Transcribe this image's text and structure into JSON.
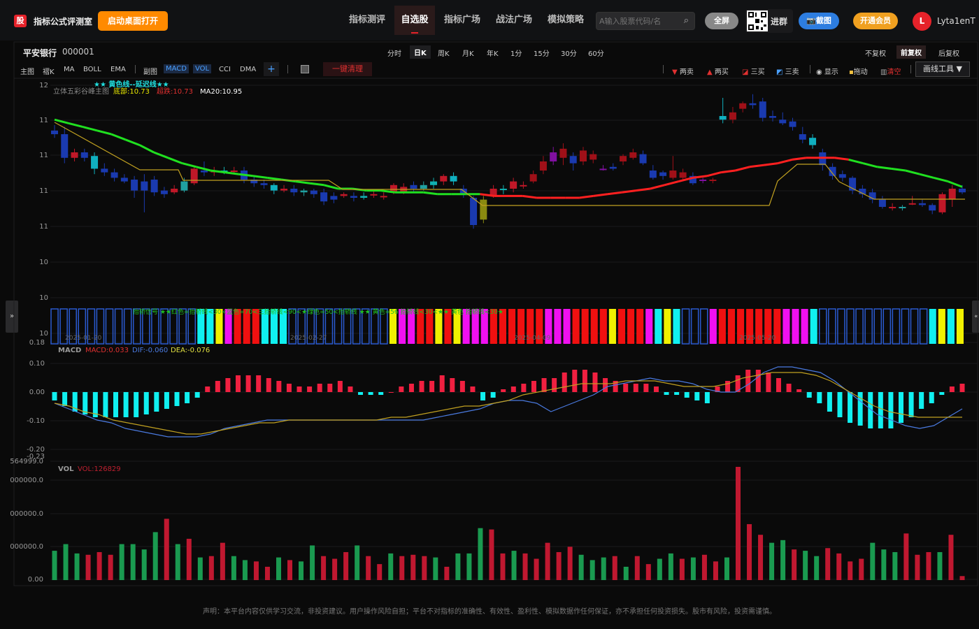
{
  "header": {
    "logo": "股",
    "app_title": "指标公式评测室",
    "desktop_button": "启动桌面打开",
    "tabs": [
      {
        "label": "指标测评"
      },
      {
        "label": "自选股"
      },
      {
        "label": "指标广场"
      },
      {
        "label": "战法广场"
      },
      {
        "label": "模拟策略"
      }
    ],
    "search_placeholder": "A输入股票代码/名",
    "fullscreen_label": "全屏",
    "group_label": "进群",
    "screenshot_label": "截图",
    "vip_label": "开通会员",
    "avatar_letter": "L",
    "username": "Lyta1enT"
  },
  "stock": {
    "name": "平安银行",
    "code": "000001"
  },
  "periods": [
    "分时",
    "日K",
    "周K",
    "月K",
    "年K",
    "1分",
    "15分",
    "30分",
    "60分"
  ],
  "active_period": "日K",
  "adjust": [
    "不复权",
    "前复权",
    "后复权"
  ],
  "indicators": [
    "主图",
    "褶K",
    "MA",
    "BOLL",
    "EMA",
    "副图",
    "MACD",
    "VOL",
    "CCI",
    "DMA"
  ],
  "clear_label": "一键清理",
  "tools": [
    {
      "label": "两卖",
      "icon": "sell-triangle-icon"
    },
    {
      "label": "两买",
      "icon": "buy-triangle-icon"
    },
    {
      "label": "三买",
      "icon": "line-icon"
    },
    {
      "label": "三卖",
      "icon": "line-icon"
    },
    {
      "label": "显示",
      "icon": "eye-icon"
    },
    {
      "label": "拖动",
      "icon": "lock-icon"
    },
    {
      "label": "清空",
      "icon": "trash-icon"
    }
  ],
  "draw_tools_label": "画线工具 ▼",
  "main_chart": {
    "legend_top": "★★ 黄色线--延迟线★★",
    "legend_name": "立体五彩谷峰主图",
    "legend_items": [
      {
        "text": "底部:10.73",
        "color": "#e8e800"
      },
      {
        "text": "超跌:10.73",
        "color": "#e03030"
      },
      {
        "text": "MA20:10.95",
        "color": "#ffffff"
      }
    ],
    "y_labels": [
      "12",
      "11",
      "11",
      "11",
      "11",
      "10",
      "10",
      "10"
    ],
    "sub_legend": "抬轿信号 ★★红色=抬轿线<30<蓝色=70<三抬轿线<90<★绿色=50<抬轿线 ★★ 黄色=56 抬轿线<30<★★ 黄色 抬轿线<30★",
    "dates": [
      "2025-01-20",
      "2025-02-27",
      "2025-04-09",
      "2025-05-20"
    ]
  },
  "macd": {
    "label": "MACD",
    "macd_val": "MACD:0.033",
    "dif": "DIF:-0.060",
    "dea": "DEA:-0.076",
    "y_labels": [
      "0.18",
      "0.10",
      "0.00",
      "-0.10",
      "-0.20",
      "-0.23"
    ]
  },
  "vol": {
    "label": "VOL",
    "vol_val": "VOL:126829",
    "y_labels": [
      "564999.0",
      "000000.0",
      "000000.0",
      "000000.0",
      "0.00"
    ]
  },
  "chart_data": {
    "type": "candlestick",
    "candles": [
      [
        11.32,
        11.3,
        11.35,
        11.28
      ],
      [
        11.3,
        11.17,
        11.34,
        11.14
      ],
      [
        11.17,
        11.2,
        11.22,
        11.15
      ],
      [
        11.2,
        11.17,
        11.22,
        11.15
      ],
      [
        11.18,
        11.11,
        11.2,
        11.08
      ],
      [
        11.11,
        11.09,
        11.14,
        11.07
      ],
      [
        11.09,
        11.06,
        11.11,
        11.04
      ],
      [
        11.06,
        11.04,
        11.08,
        11.03
      ],
      [
        11.05,
        10.99,
        11.07,
        10.95
      ],
      [
        11.04,
        10.99,
        11.08,
        10.87
      ],
      [
        11.05,
        10.98,
        11.07,
        10.96
      ],
      [
        10.99,
        10.97,
        11.01,
        10.95
      ],
      [
        10.98,
        11.0,
        11.02,
        10.97
      ],
      [
        10.99,
        11.04,
        11.06,
        10.98
      ],
      [
        11.03,
        11.11,
        11.12,
        11.02
      ],
      [
        11.1,
        11.09,
        11.15,
        11.07
      ],
      [
        11.09,
        11.1,
        11.12,
        11.07
      ],
      [
        11.1,
        11.1,
        11.12,
        11.08
      ],
      [
        11.1,
        11.1,
        11.12,
        11.08
      ],
      [
        11.1,
        11.05,
        11.12,
        11.03
      ],
      [
        11.05,
        11.03,
        11.07,
        11.01
      ],
      [
        11.03,
        11.02,
        11.05,
        11.0
      ],
      [
        11.02,
        10.99,
        11.03,
        10.97
      ],
      [
        10.99,
        11.0,
        11.02,
        10.98
      ],
      [
        11.0,
        10.98,
        11.02,
        10.96
      ],
      [
        10.98,
        10.99,
        11.0,
        10.96
      ],
      [
        10.99,
        10.97,
        11.0,
        10.95
      ],
      [
        10.98,
        10.93,
        11.0,
        10.91
      ],
      [
        10.96,
        10.94,
        10.98,
        10.92
      ],
      [
        10.96,
        10.97,
        10.98,
        10.95
      ],
      [
        10.96,
        10.95,
        10.98,
        10.93
      ],
      [
        10.95,
        10.96,
        10.98,
        10.94
      ],
      [
        10.97,
        10.97,
        10.99,
        10.95
      ],
      [
        10.96,
        10.96,
        10.98,
        10.94
      ],
      [
        10.98,
        11.02,
        11.03,
        10.97
      ],
      [
        10.98,
        11.01,
        11.03,
        10.97
      ],
      [
        11.02,
        11.0,
        11.04,
        10.98
      ],
      [
        11.0,
        11.02,
        11.04,
        10.99
      ],
      [
        11.02,
        11.04,
        11.06,
        11.0
      ],
      [
        11.04,
        11.07,
        11.08,
        11.02
      ],
      [
        11.07,
        11.04,
        11.09,
        11.02
      ],
      [
        11.0,
        10.97,
        11.02,
        10.95
      ],
      [
        10.95,
        10.8,
        10.96,
        10.78
      ],
      [
        10.83,
        10.94,
        10.96,
        10.81
      ],
      [
        10.96,
        11.0,
        11.02,
        10.95
      ],
      [
        11.0,
        11.0,
        11.02,
        10.97
      ],
      [
        11.0,
        11.04,
        11.06,
        10.98
      ],
      [
        11.02,
        11.02,
        11.04,
        11.0
      ],
      [
        11.04,
        11.08,
        11.1,
        11.03
      ],
      [
        11.1,
        11.15,
        11.18,
        11.08
      ],
      [
        11.15,
        11.2,
        11.23,
        11.13
      ],
      [
        11.17,
        11.22,
        11.25,
        11.13
      ],
      [
        11.18,
        11.14,
        11.2,
        11.1
      ],
      [
        11.15,
        11.21,
        11.23,
        11.13
      ],
      [
        11.16,
        11.19,
        11.21,
        11.14
      ],
      [
        11.11,
        11.11,
        11.13,
        11.1
      ],
      [
        11.12,
        11.11,
        11.14,
        11.1
      ],
      [
        11.15,
        11.18,
        11.19,
        11.13
      ],
      [
        11.17,
        11.2,
        11.22,
        11.16
      ],
      [
        11.19,
        11.14,
        11.21,
        11.13
      ],
      [
        11.1,
        11.06,
        11.13,
        11.05
      ],
      [
        11.09,
        11.07,
        11.1,
        11.05
      ],
      [
        11.06,
        11.1,
        11.18,
        11.05
      ],
      [
        11.06,
        11.09,
        11.11,
        11.05
      ],
      [
        11.07,
        11.03,
        11.09,
        11.02
      ],
      [
        11.05,
        11.05,
        11.06,
        11.03
      ],
      [
        11.05,
        11.05,
        11.06,
        11.03
      ],
      [
        11.4,
        11.38,
        11.5,
        11.36
      ],
      [
        11.38,
        11.42,
        11.45,
        11.36
      ],
      [
        11.44,
        11.47,
        11.48,
        11.42
      ],
      [
        11.47,
        11.46,
        11.52,
        11.44
      ],
      [
        11.48,
        11.39,
        11.5,
        11.37
      ],
      [
        11.4,
        11.39,
        11.43,
        11.37
      ],
      [
        11.38,
        11.36,
        11.42,
        11.35
      ],
      [
        11.37,
        11.34,
        11.39,
        11.32
      ],
      [
        11.3,
        11.27,
        11.34,
        11.25
      ],
      [
        11.28,
        11.24,
        11.3,
        11.22
      ],
      [
        11.2,
        11.13,
        11.22,
        11.1
      ],
      [
        11.12,
        11.07,
        11.14,
        11.05
      ],
      [
        11.08,
        11.06,
        11.1,
        11.04
      ],
      [
        11.06,
        10.99,
        11.07,
        10.97
      ],
      [
        11.0,
        10.97,
        11.02,
        10.95
      ],
      [
        10.98,
        10.94,
        11.0,
        10.92
      ],
      [
        10.94,
        10.9,
        10.96,
        10.89
      ],
      [
        10.9,
        10.9,
        10.92,
        10.88
      ],
      [
        10.9,
        10.9,
        10.91,
        10.88
      ],
      [
        10.92,
        10.92,
        10.96,
        10.91
      ],
      [
        10.92,
        10.91,
        10.94,
        10.9
      ],
      [
        10.91,
        10.88,
        10.92,
        10.86
      ],
      [
        10.87,
        10.97,
        10.98,
        10.86
      ],
      [
        10.94,
        11.0,
        11.02,
        10.9
      ],
      [
        11.0,
        10.98,
        11.02,
        10.97
      ]
    ],
    "volume": [
      {
        "v": 2200,
        "up": true
      },
      {
        "v": 2700,
        "up": true
      },
      {
        "v": 2000,
        "up": true
      },
      {
        "v": 1900,
        "up": false
      },
      {
        "v": 2100,
        "up": false
      },
      {
        "v": 1900,
        "up": false
      },
      {
        "v": 2700,
        "up": true
      },
      {
        "v": 2700,
        "up": true
      },
      {
        "v": 2300,
        "up": true
      },
      {
        "v": 3600,
        "up": true
      },
      {
        "v": 4600,
        "up": false
      },
      {
        "v": 2700,
        "up": true
      },
      {
        "v": 3100,
        "up": false
      },
      {
        "v": 1700,
        "up": true
      },
      {
        "v": 1800,
        "up": false
      },
      {
        "v": 2800,
        "up": false
      },
      {
        "v": 1800,
        "up": true
      },
      {
        "v": 1500,
        "up": true
      },
      {
        "v": 1400,
        "up": false
      },
      {
        "v": 1000,
        "up": false
      },
      {
        "v": 1700,
        "up": true
      },
      {
        "v": 1500,
        "up": false
      },
      {
        "v": 1400,
        "up": true
      },
      {
        "v": 2600,
        "up": true
      },
      {
        "v": 1800,
        "up": false
      },
      {
        "v": 1600,
        "up": false
      },
      {
        "v": 2100,
        "up": false
      },
      {
        "v": 2600,
        "up": true
      },
      {
        "v": 1800,
        "up": false
      },
      {
        "v": 1200,
        "up": false
      },
      {
        "v": 2000,
        "up": true
      },
      {
        "v": 1800,
        "up": false
      },
      {
        "v": 1900,
        "up": false
      },
      {
        "v": 1800,
        "up": false
      },
      {
        "v": 1700,
        "up": true
      },
      {
        "v": 1000,
        "up": false
      },
      {
        "v": 2000,
        "up": true
      },
      {
        "v": 2000,
        "up": true
      },
      {
        "v": 3900,
        "up": true
      },
      {
        "v": 3800,
        "up": false
      },
      {
        "v": 2000,
        "up": false
      },
      {
        "v": 2200,
        "up": true
      },
      {
        "v": 2000,
        "up": false
      },
      {
        "v": 1600,
        "up": false
      },
      {
        "v": 2800,
        "up": false
      },
      {
        "v": 2100,
        "up": false
      },
      {
        "v": 2500,
        "up": false
      },
      {
        "v": 1900,
        "up": true
      },
      {
        "v": 1500,
        "up": true
      },
      {
        "v": 1700,
        "up": true
      },
      {
        "v": 1800,
        "up": false
      },
      {
        "v": 1000,
        "up": true
      },
      {
        "v": 1800,
        "up": false
      },
      {
        "v": 1200,
        "up": false
      },
      {
        "v": 1600,
        "up": true
      },
      {
        "v": 2000,
        "up": true
      },
      {
        "v": 1600,
        "up": false
      },
      {
        "v": 1700,
        "up": true
      },
      {
        "v": 1900,
        "up": false
      },
      {
        "v": 1400,
        "up": false
      },
      {
        "v": 1700,
        "up": true
      },
      {
        "v": 8500,
        "up": false
      },
      {
        "v": 4200,
        "up": false
      },
      {
        "v": 3400,
        "up": false
      },
      {
        "v": 2800,
        "up": true
      },
      {
        "v": 3000,
        "up": true
      },
      {
        "v": 2300,
        "up": false
      },
      {
        "v": 2200,
        "up": true
      },
      {
        "v": 1800,
        "up": true
      },
      {
        "v": 2400,
        "up": false
      },
      {
        "v": 2000,
        "up": false
      },
      {
        "v": 1400,
        "up": false
      },
      {
        "v": 1600,
        "up": false
      },
      {
        "v": 2800,
        "up": true
      },
      {
        "v": 2300,
        "up": true
      },
      {
        "v": 2100,
        "up": true
      },
      {
        "v": 3500,
        "up": false
      },
      {
        "v": 1900,
        "up": false
      },
      {
        "v": 2100,
        "up": false
      },
      {
        "v": 2100,
        "up": true
      },
      {
        "v": 3400,
        "up": false
      },
      {
        "v": 300,
        "up": false
      }
    ],
    "macd_bars": [
      -0.03,
      -0.05,
      -0.07,
      -0.08,
      -0.09,
      -0.09,
      -0.09,
      -0.09,
      -0.09,
      -0.08,
      -0.07,
      -0.06,
      -0.05,
      -0.04,
      -0.02,
      0.02,
      0.04,
      0.05,
      0.06,
      0.06,
      0.06,
      0.05,
      0.04,
      0.03,
      0.02,
      0.02,
      0.03,
      0.03,
      0.04,
      0.02,
      -0.01,
      -0.01,
      -0.01,
      0.0,
      0.02,
      0.03,
      0.04,
      0.04,
      0.06,
      0.05,
      0.04,
      0.02,
      -0.03,
      -0.02,
      0.01,
      0.02,
      0.03,
      0.04,
      0.05,
      0.05,
      0.07,
      0.08,
      0.08,
      0.07,
      0.05,
      0.04,
      0.03,
      0.03,
      0.03,
      0.02,
      -0.01,
      -0.01,
      -0.02,
      -0.03,
      -0.04,
      0.02,
      0.04,
      0.06,
      0.08,
      0.08,
      0.07,
      0.05,
      0.03,
      0.01,
      -0.02,
      -0.04,
      -0.07,
      -0.09,
      -0.11,
      -0.12,
      -0.13,
      -0.13,
      -0.13,
      -0.11,
      -0.09,
      -0.06,
      -0.04,
      -0.01,
      0.02,
      0.03
    ],
    "dif": [
      -0.04,
      -0.06,
      -0.08,
      -0.1,
      -0.11,
      -0.13,
      -0.14,
      -0.15,
      -0.16,
      -0.16,
      -0.16,
      -0.15,
      -0.13,
      -0.12,
      -0.11,
      -0.1,
      -0.1,
      -0.1,
      -0.1,
      -0.1,
      -0.1,
      -0.1,
      -0.1,
      -0.1,
      -0.1,
      -0.1,
      -0.1,
      -0.09,
      -0.08,
      -0.07,
      -0.06,
      -0.04,
      -0.03,
      -0.03,
      -0.04,
      -0.07,
      -0.05,
      -0.03,
      -0.01,
      0.02,
      0.03,
      0.04,
      0.05,
      0.04,
      0.04,
      0.03,
      0.01,
      0.0,
      0.0,
      0.03,
      0.07,
      0.09,
      0.09,
      0.08,
      0.07,
      0.04,
      0.0,
      -0.04,
      -0.08,
      -0.1,
      -0.12,
      -0.13,
      -0.12,
      -0.09,
      -0.06
    ],
    "dea": [
      -0.04,
      -0.05,
      -0.07,
      -0.08,
      -0.1,
      -0.11,
      -0.12,
      -0.13,
      -0.14,
      -0.15,
      -0.15,
      -0.14,
      -0.13,
      -0.12,
      -0.11,
      -0.11,
      -0.1,
      -0.1,
      -0.1,
      -0.1,
      -0.1,
      -0.1,
      -0.1,
      -0.09,
      -0.09,
      -0.08,
      -0.07,
      -0.06,
      -0.05,
      -0.05,
      -0.04,
      -0.03,
      -0.01,
      0.0,
      0.01,
      0.02,
      0.03,
      0.03,
      0.03,
      0.04,
      0.04,
      0.04,
      0.03,
      0.02,
      0.02,
      0.02,
      0.03,
      0.05,
      0.06,
      0.07,
      0.07,
      0.07,
      0.06,
      0.04,
      0.01,
      -0.02,
      -0.05,
      -0.07,
      -0.08,
      -0.09,
      -0.09,
      -0.09,
      -0.09
    ],
    "ma_line": [
      11.38,
      11.36,
      11.34,
      11.32,
      11.3,
      11.27,
      11.24,
      11.2,
      11.17,
      11.14,
      11.12,
      11.1,
      11.09,
      11.08,
      11.07,
      11.06,
      11.05,
      11.04,
      11.03,
      11.02,
      11.0,
      11.0,
      10.99,
      10.99,
      10.98,
      10.98,
      10.98,
      10.97,
      10.97,
      10.97,
      10.97,
      10.96,
      10.96,
      10.96,
      10.95,
      10.95,
      10.95,
      10.95,
      10.96,
      10.97,
      10.98,
      10.99,
      11.0,
      11.02,
      11.04,
      11.06,
      11.07,
      11.09,
      11.1,
      11.12,
      11.13,
      11.14,
      11.16,
      11.17,
      11.17,
      11.17,
      11.16,
      11.14,
      11.12,
      11.11,
      11.1,
      11.08,
      11.06,
      11.04,
      11.01
    ],
    "strip_colors": [
      "b",
      "b",
      "b",
      "b",
      "b",
      "b",
      "b",
      "b",
      "b",
      "b",
      "b",
      "b",
      "b",
      "b",
      "b",
      "b",
      "c",
      "c",
      "y",
      "m",
      "r",
      "r",
      "r",
      "c",
      "c",
      "c",
      "b",
      "b",
      "b",
      "b",
      "b",
      "b",
      "b",
      "b",
      "b",
      "b",
      "b",
      "y",
      "m",
      "m",
      "r",
      "r",
      "y",
      "r",
      "y",
      "m",
      "m",
      "m",
      "r",
      "r",
      "r",
      "r",
      "r",
      "r",
      "m",
      "m",
      "m",
      "r",
      "r",
      "r",
      "r",
      "y",
      "r",
      "r",
      "r",
      "m",
      "c",
      "y",
      "c",
      "b",
      "b",
      "b",
      "m",
      "r",
      "r",
      "r",
      "r",
      "r",
      "r",
      "r",
      "m",
      "m",
      "m",
      "c",
      "b",
      "b",
      "b",
      "b",
      "b",
      "b",
      "b",
      "b",
      "b",
      "b",
      "b",
      "b",
      "c",
      "y",
      "c",
      "y"
    ]
  },
  "disclaimer": "声明：本平台内容仅供学习交流，非投资建议。用户操作风险自担；平台不对指标的准确性、有效性、盈利性、模拟数据作任何保证，亦不承担任何投资损失。股市有风险，投资需谨慎。"
}
